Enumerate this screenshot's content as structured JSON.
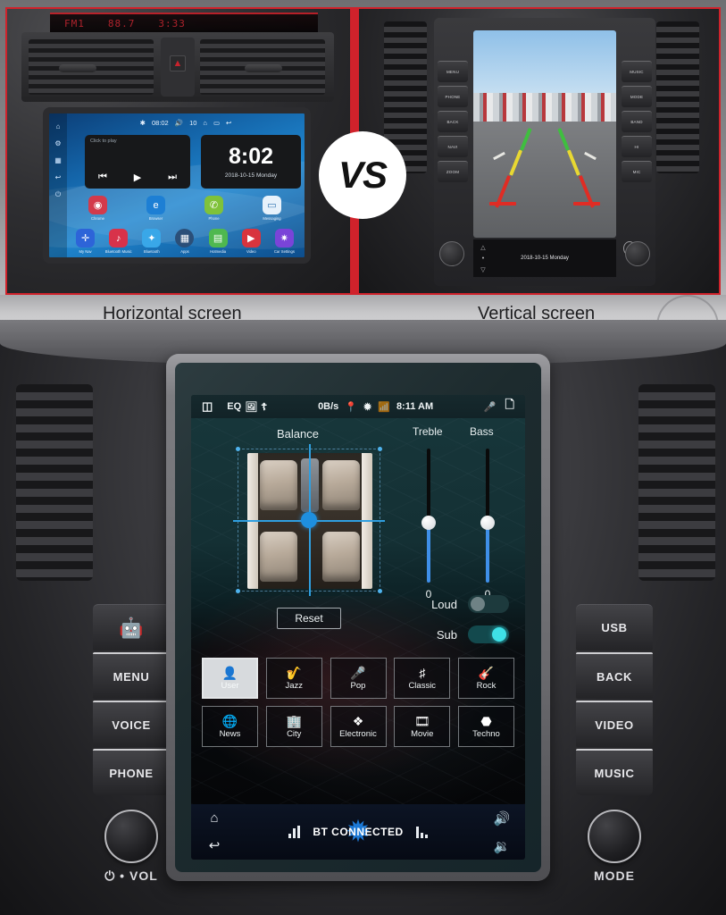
{
  "comparison": {
    "left": {
      "caption": "Horizontal screen",
      "led": {
        "band": "FM1",
        "frequency": "88.7",
        "clock": "3:33"
      },
      "screen": {
        "status": {
          "bt": "BT",
          "data": "08:02",
          "vol": "10"
        },
        "player_hint": "Click to play",
        "clock": "8:02",
        "date": "2018-10-15  Monday",
        "apps_row1": [
          {
            "label": "Chrome",
            "icon": "browser-icon",
            "color": "#d33a4b"
          },
          {
            "label": "Browser",
            "icon": "edge-icon",
            "color": "#1d7fd4"
          },
          {
            "label": "Phone",
            "icon": "phone-icon",
            "color": "#7fc23a"
          },
          {
            "label": "Messaging",
            "icon": "message-icon",
            "color": "#e8f2fb"
          }
        ],
        "apps_row2": [
          {
            "label": "My Nav",
            "icon": "navigation-icon",
            "color": "#2d64d8"
          },
          {
            "label": "Bluetooth Music",
            "icon": "music-icon",
            "color": "#d8324a"
          },
          {
            "label": "Bluetooth",
            "icon": "bluetooth-icon",
            "color": "#39a7e8"
          },
          {
            "label": "Apps",
            "icon": "apps-grid-icon",
            "color": "#2b4f78"
          },
          {
            "label": "Hotmedia",
            "icon": "radio-icon",
            "color": "#4fb84f"
          },
          {
            "label": "Video",
            "icon": "video-icon",
            "color": "#d8343e"
          },
          {
            "label": "Car Settings",
            "icon": "gear-icon",
            "color": "#7a44d8"
          }
        ]
      }
    },
    "right": {
      "caption": "Vertical screen",
      "camera_date": "2018-10-15  Monday",
      "side_buttons_left": [
        "MENU",
        "PHONE",
        "BACK",
        "NAVI",
        "ZOOM"
      ],
      "side_buttons_right": [
        "MUSIC",
        "MODE",
        "BAND",
        "HI",
        "MIC"
      ]
    },
    "vs_label": "VS"
  },
  "main": {
    "statusbar": {
      "split_icon": "split-screen-icon",
      "eq_label": "EQ",
      "picture_icon": "picture-icon",
      "usb_icon": "usb-icon",
      "data_rate": "0B/s",
      "location_icon": "location-pin-icon",
      "bluetooth_icon": "bluetooth-icon",
      "signal_icon": "signal-icon",
      "time": "8:11 AM",
      "mic_icon": "microphone-icon",
      "recents_icon": "recents-icon"
    },
    "eq": {
      "balance_label": "Balance",
      "treble": {
        "label": "Treble",
        "value": "0"
      },
      "bass": {
        "label": "Bass",
        "value": "0"
      },
      "reset_label": "Reset",
      "loud": {
        "label": "Loud",
        "state": "off"
      },
      "sub": {
        "label": "Sub",
        "state": "on"
      },
      "presets_row1": [
        {
          "label": "User",
          "icon": "user-icon",
          "selected": true
        },
        {
          "label": "Jazz",
          "icon": "saxophone-icon",
          "selected": false
        },
        {
          "label": "Pop",
          "icon": "microphone-icon",
          "selected": false
        },
        {
          "label": "Classic",
          "icon": "piano-icon",
          "selected": false
        },
        {
          "label": "Rock",
          "icon": "guitar-icon",
          "selected": false
        }
      ],
      "presets_row2": [
        {
          "label": "News",
          "icon": "news-globe-icon",
          "selected": false
        },
        {
          "label": "City",
          "icon": "city-buildings-icon",
          "selected": false
        },
        {
          "label": "Electronic",
          "icon": "electronic-icon",
          "selected": false
        },
        {
          "label": "Movie",
          "icon": "film-reel-icon",
          "selected": false
        },
        {
          "label": "Techno",
          "icon": "techno-icon",
          "selected": false
        }
      ]
    },
    "bottombar": {
      "home_icon": "home-icon",
      "back_icon": "back-arrow-icon",
      "status_text": "BT CONNECTED",
      "bt_logo_icon": "bluetooth-logo-icon",
      "volume_up_icon": "volume-up-icon",
      "volume_down_icon": "volume-down-icon"
    },
    "hardware": {
      "left_buttons": [
        {
          "label": "",
          "icon": "android-robot-icon"
        },
        {
          "label": "MENU",
          "icon": ""
        },
        {
          "label": "VOICE",
          "icon": ""
        },
        {
          "label": "PHONE",
          "icon": ""
        }
      ],
      "right_buttons": [
        {
          "label": "USB",
          "icon": ""
        },
        {
          "label": "BACK",
          "icon": ""
        },
        {
          "label": "VIDEO",
          "icon": ""
        },
        {
          "label": "MUSIC",
          "icon": ""
        }
      ],
      "left_knob_label": "VOL",
      "left_knob_icon": "power-icon",
      "right_knob_label": "MODE"
    }
  },
  "colors": {
    "accent_red": "#d0222b",
    "slider_blue": "#3f8fe8",
    "balance_blue": "#1e8fe0",
    "toggle_on_cyan": "#3fe0e6",
    "bt_blue": "#1e7fe0",
    "screen_teal": "#17363a"
  }
}
